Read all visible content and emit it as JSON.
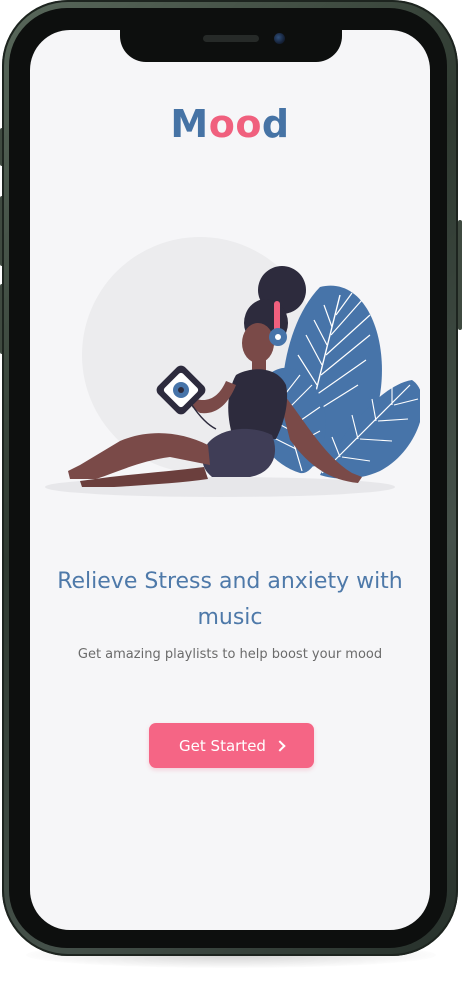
{
  "app": {
    "logo_letters": [
      {
        "char": "M",
        "color": "#4673a5"
      },
      {
        "char": "o",
        "color": "#f0607e"
      },
      {
        "char": "o",
        "color": "#f0607e"
      },
      {
        "char": "d",
        "color": "#4673a5"
      }
    ]
  },
  "onboarding": {
    "illustration": "woman-listening-music-illustration",
    "headline": "Relieve Stress and anxiety with music",
    "subtext": "Get amazing playlists to help boost your mood",
    "cta_label": "Get Started",
    "cta_icon": "chevron-right-icon"
  },
  "colors": {
    "brand_blue": "#4673a5",
    "accent_pink": "#f56585",
    "background": "#f6f6f8"
  }
}
